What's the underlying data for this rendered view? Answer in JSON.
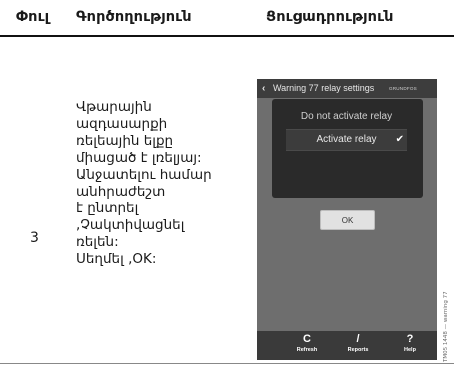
{
  "table": {
    "headers": [
      "Փուլ",
      "Գործողություն",
      "Ցուցադրություն"
    ],
    "row": {
      "step": "3",
      "description_lines": [
        "Վթարային",
        "ազդասարքի",
        "ռելեային ելքը",
        "միացած է լռելյայ:",
        "Անջատելու համար",
        "անհրաժեշտ",
        "է ընտրել",
        ",Չակտիվացնել",
        "ռելեն:",
        "Սեղմել ,OK:"
      ]
    }
  },
  "phone": {
    "back_glyph": "‹",
    "title": "Warning 77 relay settings",
    "brand": "GRUNDFOS",
    "brand_icon": "grundfos-logo-icon",
    "options": [
      "Do not activate relay",
      "Activate relay"
    ],
    "selected_option_index": 1,
    "check_glyph": "✔",
    "ok_label": "OK",
    "toolbar": [
      {
        "label": "Refresh",
        "icon": "refresh-icon",
        "glyph": "C"
      },
      {
        "label": "Reports",
        "icon": "reports-icon",
        "glyph": "/"
      },
      {
        "label": "Help",
        "icon": "help-icon",
        "glyph": "?"
      }
    ],
    "colors": {
      "screen_bg": "#6e6e6e",
      "bar_bg": "#3a3a3a",
      "dialog_bg": "#2a2a2a",
      "selected_bg": "#3c3c3c",
      "ok_bg": "#e1e1e1"
    }
  },
  "figure_code": "TM05 1448 — warning 77"
}
